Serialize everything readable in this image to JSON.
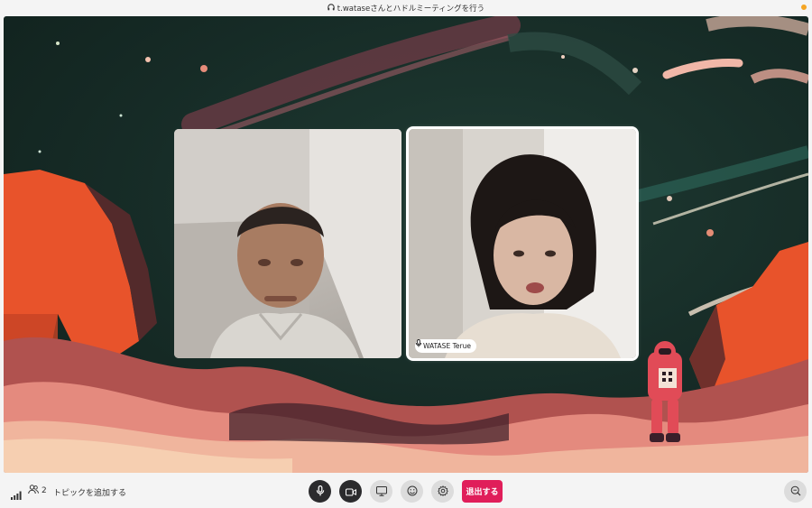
{
  "window": {
    "title": "t.wataseさんとハドルミーティングを行う",
    "title_icon": "headphones-icon",
    "status_color": "#f5a524"
  },
  "huddle": {
    "participants": [
      {
        "name": ""
      },
      {
        "name": "WATASE Terue",
        "speaking": true
      }
    ]
  },
  "bottombar": {
    "participant_count": "2",
    "add_topic_label": "トピックを追加する",
    "controls": [
      {
        "icon": "microphone-icon"
      },
      {
        "icon": "video-camera-icon"
      },
      {
        "icon": "screen-share-icon"
      },
      {
        "icon": "emoji-reaction-icon"
      },
      {
        "icon": "settings-gear-icon"
      }
    ],
    "leave_label": "退出する",
    "leave_color": "#e01e5a"
  }
}
